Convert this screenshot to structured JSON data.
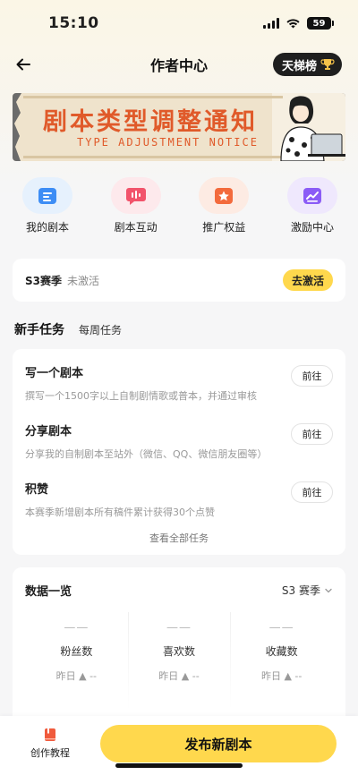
{
  "status_bar": {
    "time": "15:10",
    "battery": "59"
  },
  "nav": {
    "title": "作者中心",
    "rank_label": "天梯榜"
  },
  "banner": {
    "title": "剧本类型调整通知",
    "subtitle": "TYPE ADJUSTMENT NOTICE"
  },
  "quick_actions": [
    {
      "label": "我的剧本",
      "icon": "folder-icon",
      "color": "#3d8df5"
    },
    {
      "label": "剧本互动",
      "icon": "chat-bubble-icon",
      "color": "#f2536b"
    },
    {
      "label": "推广权益",
      "icon": "star-badge-icon",
      "color": "#f36a3c"
    },
    {
      "label": "激励中心",
      "icon": "trend-chart-icon",
      "color": "#8b5cf6"
    }
  ],
  "season": {
    "name": "S3赛季",
    "state": "未激活",
    "button": "去激活"
  },
  "task_tabs": {
    "active": "新手任务",
    "inactive": "每周任务"
  },
  "tasks": [
    {
      "name": "写一个剧本",
      "desc": "撰写一个1500字以上自制剧情歌或普本，并通过审核",
      "action": "前往"
    },
    {
      "name": "分享剧本",
      "desc": "分享我的自制剧本至站外（微信、QQ、微信朋友圈等）",
      "action": "前往"
    },
    {
      "name": "积赞",
      "desc": "本赛季新增剧本所有稿件累计获得30个点赞",
      "action": "前往"
    }
  ],
  "view_all": "查看全部任务",
  "data_overview": {
    "title": "数据一览",
    "season_select": "S3 赛季",
    "stats": [
      {
        "value": "——",
        "label": "粉丝数",
        "yesterday": "昨日 ▲ --"
      },
      {
        "value": "——",
        "label": "喜欢数",
        "yesterday": "昨日 ▲ --"
      },
      {
        "value": "——",
        "label": "收藏数",
        "yesterday": "昨日 ▲ --"
      }
    ]
  },
  "bottom_bar": {
    "tutorial": "创作教程",
    "publish": "发布新剧本"
  },
  "colors": {
    "accent_yellow": "#ffd84d",
    "banner_orange": "#e05a2a"
  }
}
